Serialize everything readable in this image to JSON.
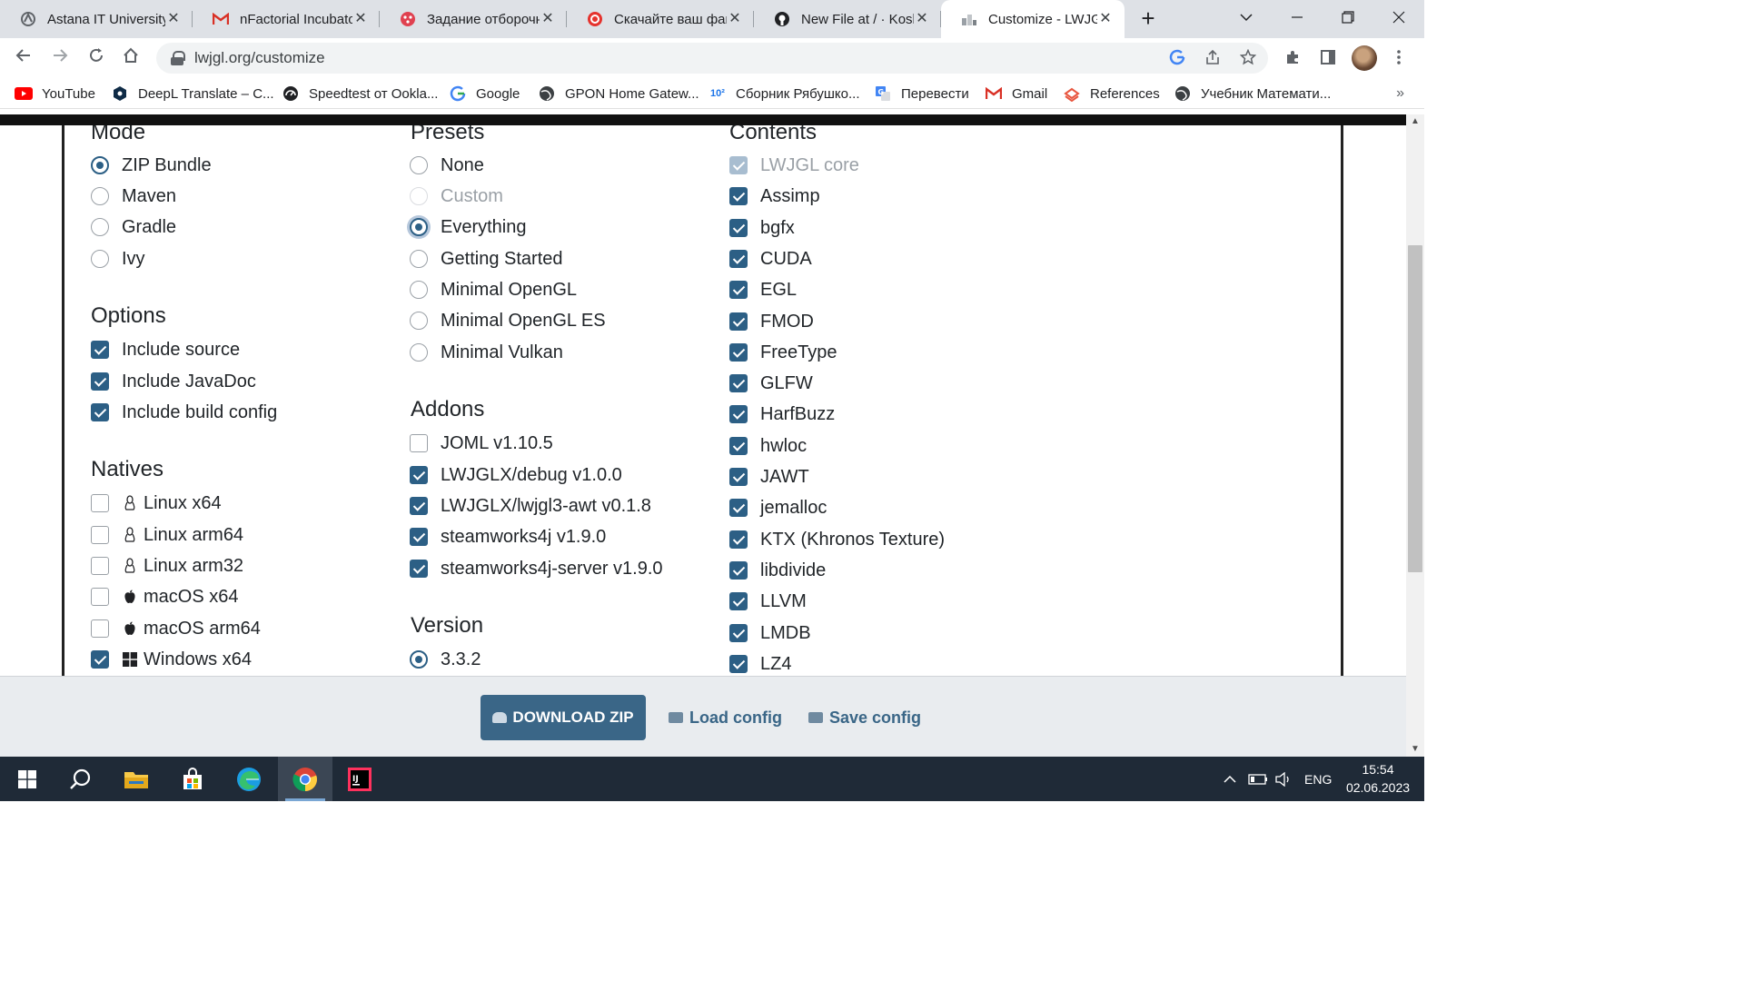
{
  "browser": {
    "tabs": [
      {
        "title": "Astana IT University",
        "favicon": "university-icon",
        "active": false
      },
      {
        "title": "nFactorial Incubato",
        "favicon": "gmail-icon",
        "active": false
      },
      {
        "title": "Задание отборочн",
        "favicon": "dice-icon",
        "active": false
      },
      {
        "title": "Скачайте ваш фай",
        "favicon": "ilovepdf-icon",
        "active": false
      },
      {
        "title": "New File at / · Kosh",
        "favicon": "github-icon",
        "active": false
      },
      {
        "title": "Customize - LWJGL",
        "favicon": "lwjgl-icon",
        "active": true
      }
    ],
    "address": "lwjgl.org/customize",
    "bookmarks": [
      {
        "label": "YouTube",
        "icon": "youtube-icon"
      },
      {
        "label": "DeepL Translate – C...",
        "icon": "deepl-icon"
      },
      {
        "label": "Speedtest от Ookla...",
        "icon": "speedtest-icon"
      },
      {
        "label": "Google",
        "icon": "google-icon"
      },
      {
        "label": "GPON Home Gatew...",
        "icon": "globe-icon"
      },
      {
        "label": "Сборник Рябушко...",
        "icon": "books-icon"
      },
      {
        "label": "Перевести",
        "icon": "translate-icon"
      },
      {
        "label": "Gmail",
        "icon": "gmail-icon"
      },
      {
        "label": "References",
        "icon": "references-icon"
      },
      {
        "label": "Учебник Математи...",
        "icon": "globe-icon"
      }
    ],
    "more_bookmarks": "»"
  },
  "page": {
    "mode": {
      "heading": "Mode",
      "options": [
        {
          "label": "ZIP Bundle",
          "selected": true
        },
        {
          "label": "Maven",
          "selected": false
        },
        {
          "label": "Gradle",
          "selected": false
        },
        {
          "label": "Ivy",
          "selected": false
        }
      ]
    },
    "options": {
      "heading": "Options",
      "items": [
        {
          "label": "Include source",
          "checked": true
        },
        {
          "label": "Include JavaDoc",
          "checked": true
        },
        {
          "label": "Include build config",
          "checked": true
        }
      ]
    },
    "natives": {
      "heading": "Natives",
      "items": [
        {
          "label": "Linux x64",
          "checked": false,
          "icon": "linux-icon"
        },
        {
          "label": "Linux arm64",
          "checked": false,
          "icon": "linux-icon"
        },
        {
          "label": "Linux arm32",
          "checked": false,
          "icon": "linux-icon"
        },
        {
          "label": "macOS x64",
          "checked": false,
          "icon": "apple-icon"
        },
        {
          "label": "macOS arm64",
          "checked": false,
          "icon": "apple-icon"
        },
        {
          "label": "Windows x64",
          "checked": true,
          "icon": "windows-icon"
        }
      ]
    },
    "presets": {
      "heading": "Presets",
      "options": [
        {
          "label": "None",
          "selected": false,
          "disabled": false
        },
        {
          "label": "Custom",
          "selected": false,
          "disabled": true
        },
        {
          "label": "Everything",
          "selected": true,
          "disabled": false
        },
        {
          "label": "Getting Started",
          "selected": false,
          "disabled": false
        },
        {
          "label": "Minimal OpenGL",
          "selected": false,
          "disabled": false
        },
        {
          "label": "Minimal OpenGL ES",
          "selected": false,
          "disabled": false
        },
        {
          "label": "Minimal Vulkan",
          "selected": false,
          "disabled": false
        }
      ]
    },
    "addons": {
      "heading": "Addons",
      "items": [
        {
          "label": "JOML v1.10.5",
          "checked": false
        },
        {
          "label": "LWJGLX/debug v1.0.0",
          "checked": true
        },
        {
          "label": "LWJGLX/lwjgl3-awt v0.1.8",
          "checked": true
        },
        {
          "label": "steamworks4j v1.9.0",
          "checked": true
        },
        {
          "label": "steamworks4j-server v1.9.0",
          "checked": true
        }
      ]
    },
    "version": {
      "heading": "Version",
      "options": [
        {
          "label": "3.3.2",
          "selected": true
        }
      ]
    },
    "contents": {
      "heading": "Contents",
      "items": [
        {
          "label": "LWJGL core",
          "checked": true,
          "disabled": true
        },
        {
          "label": "Assimp",
          "checked": true
        },
        {
          "label": "bgfx",
          "checked": true
        },
        {
          "label": "CUDA",
          "checked": true
        },
        {
          "label": "EGL",
          "checked": true
        },
        {
          "label": "FMOD",
          "checked": true
        },
        {
          "label": "FreeType",
          "checked": true
        },
        {
          "label": "GLFW",
          "checked": true
        },
        {
          "label": "HarfBuzz",
          "checked": true
        },
        {
          "label": "hwloc",
          "checked": true
        },
        {
          "label": "JAWT",
          "checked": true
        },
        {
          "label": "jemalloc",
          "checked": true
        },
        {
          "label": "KTX (Khronos Texture)",
          "checked": true
        },
        {
          "label": "libdivide",
          "checked": true
        },
        {
          "label": "LLVM",
          "checked": true
        },
        {
          "label": "LMDB",
          "checked": true
        },
        {
          "label": "LZ4",
          "checked": true
        }
      ]
    },
    "actions": {
      "download": "DOWNLOAD ZIP",
      "load": "Load config",
      "save": "Save config"
    }
  },
  "taskbar": {
    "apps": [
      "start-icon",
      "search-icon",
      "file-explorer-icon",
      "store-icon",
      "edge-icon",
      "chrome-icon",
      "intellij-icon"
    ],
    "active_app": "chrome-icon",
    "language": "ENG",
    "time": "15:54",
    "date": "02.06.2023"
  },
  "colors": {
    "accent": "#2c5f85",
    "download_button": "#3a6687",
    "taskbar": "#1f2a37"
  }
}
